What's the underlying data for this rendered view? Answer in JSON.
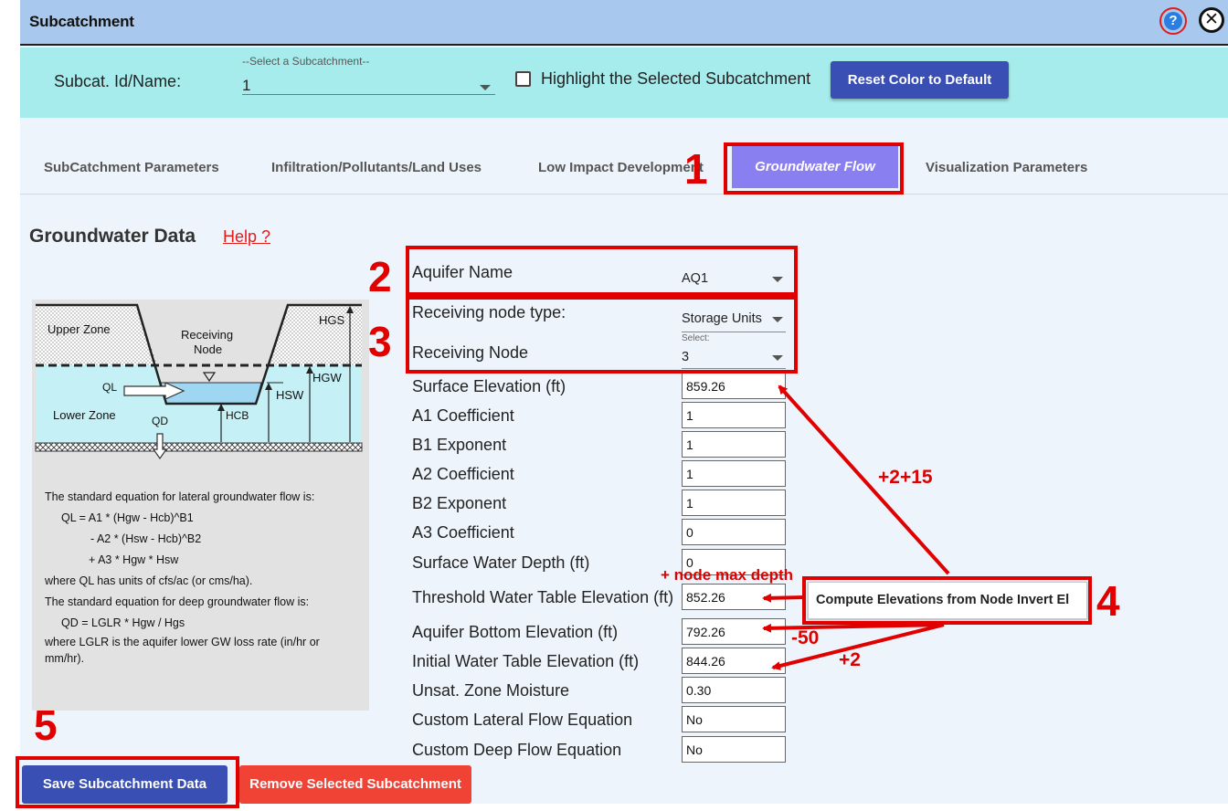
{
  "window": {
    "title": "Subcatchment"
  },
  "selector": {
    "label": "Subcat. Id/Name:",
    "floating_label": "--Select a Subcatchment--",
    "value": "1",
    "highlight_label": "Highlight the Selected Subcatchment",
    "highlight_checked": false,
    "reset_button": "Reset Color to Default"
  },
  "tabs": [
    {
      "label": "SubCatchment Parameters"
    },
    {
      "label": "Infiltration/Pollutants/Land Uses"
    },
    {
      "label": "Low Impact Development"
    },
    {
      "label": "Groundwater Flow",
      "active": true
    },
    {
      "label": "Visualization Parameters"
    }
  ],
  "section": {
    "title": "Groundwater Data",
    "help_link": "Help ?"
  },
  "diagram": {
    "upper_zone": "Upper Zone",
    "receiving": "Receiving",
    "node": "Node",
    "lower_zone": "Lower Zone",
    "ql": "QL",
    "qd": "QD",
    "hgs": "HGS",
    "hgw": "HGW",
    "hsw": "HSW",
    "hcb": "HCB",
    "equations": [
      "The standard equation for lateral groundwater flow is:",
      "QL  =  A1 * (Hgw - Hcb)^B1",
      "- A2 * (Hsw - Hcb)^B2",
      "+ A3 * Hgw * Hsw",
      "where QL has units of cfs/ac (or cms/ha).",
      "The standard equation for deep groundwater flow is:",
      "QD  =  LGLR * Hgw / Hgs",
      "where LGLR is the aquifer lower GW loss rate (in/hr or",
      "mm/hr)."
    ]
  },
  "form": {
    "aquifer_name": {
      "label": "Aquifer Name",
      "value": "AQ1"
    },
    "receiving_node_type": {
      "label": "Receiving node type:",
      "value": "Storage Units"
    },
    "receiving_node": {
      "label": "Receiving Node",
      "floating": "Select:",
      "value": "3"
    },
    "fields": [
      {
        "label": "Surface Elevation (ft)",
        "value": "859.26"
      },
      {
        "label": "A1 Coefficient",
        "value": "1"
      },
      {
        "label": "B1 Exponent",
        "value": "1"
      },
      {
        "label": "A2 Coefficient",
        "value": "1"
      },
      {
        "label": "B2 Exponent",
        "value": "1"
      },
      {
        "label": "A3 Coefficient",
        "value": "0"
      },
      {
        "label": "Surface Water Depth (ft)",
        "value": "0"
      },
      {
        "label": "Threshold Water Table Elevation (ft)",
        "value": "852.26"
      },
      {
        "label": "Aquifer Bottom Elevation (ft)",
        "value": "792.26"
      },
      {
        "label": "Initial Water Table Elevation (ft)",
        "value": "844.26"
      },
      {
        "label": "Unsat. Zone Moisture",
        "value": "0.30"
      },
      {
        "label": "Custom Lateral Flow Equation",
        "value": "No"
      },
      {
        "label": "Custom Deep Flow Equation",
        "value": "No"
      }
    ],
    "compute_button": "Compute Elevations from Node Invert El"
  },
  "actions": {
    "save": "Save Subcatchment Data",
    "remove": "Remove Selected Subcatchment"
  },
  "annotations": {
    "n1": "1",
    "n2": "2",
    "n3": "3",
    "n4": "4",
    "n5": "5",
    "plus_2_15": "+2+15",
    "plus_node_max_depth": "+ node max depth",
    "minus_50": "-50",
    "plus_2": "+2",
    "color": "#e00000"
  },
  "colors": {
    "title_bar": "#a9c8ee",
    "select_bar": "#a7ecec",
    "active_tab": "#8a7ff0",
    "primary_button": "#3a4fb4",
    "danger_button": "#f14236"
  }
}
